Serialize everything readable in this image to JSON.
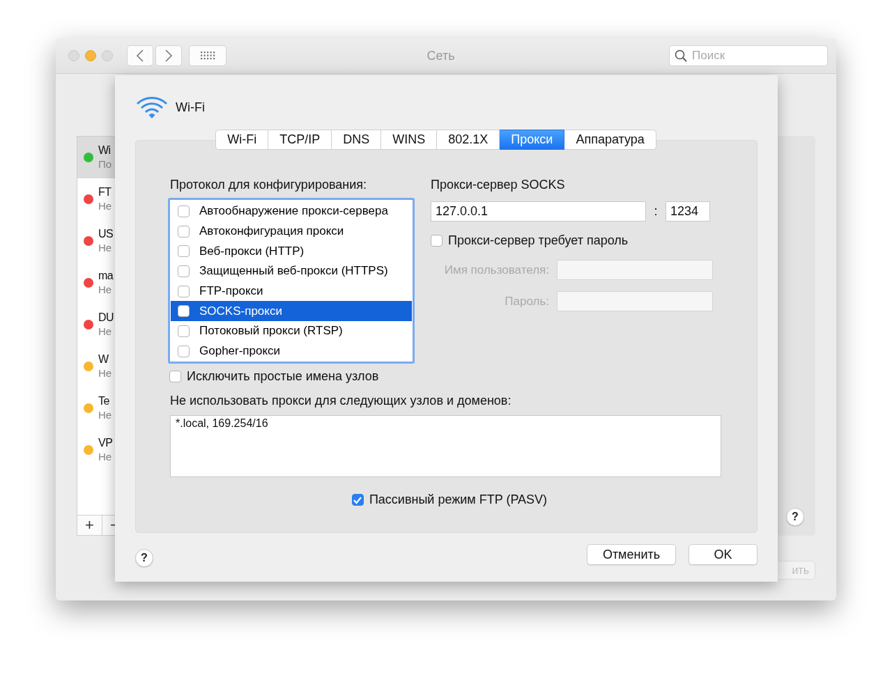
{
  "window": {
    "title": "Сеть",
    "search": {
      "placeholder": "Поиск"
    }
  },
  "services": [
    {
      "name": "Wi",
      "status": "По",
      "color": "#2fbf3c",
      "selected": true
    },
    {
      "name": "FT",
      "status": "Не",
      "color": "#f04545",
      "selected": false
    },
    {
      "name": "US",
      "status": "Не",
      "color": "#f04545",
      "selected": false
    },
    {
      "name": "ma",
      "status": "Не",
      "color": "#f04545",
      "selected": false
    },
    {
      "name": "DU",
      "status": "Не",
      "color": "#f04545",
      "selected": false
    },
    {
      "name": "W",
      "status": "Не",
      "color": "#f7b731",
      "selected": false
    },
    {
      "name": "Te",
      "status": "Не",
      "color": "#f7b731",
      "selected": false
    },
    {
      "name": "VP",
      "status": "Не",
      "color": "#f7b731",
      "selected": false
    }
  ],
  "list_buttons": [
    "+",
    "−"
  ],
  "window_help": "?",
  "apply_button": {
    "label": "ить",
    "disabled": true
  },
  "sheet": {
    "title": "Wi-Fi",
    "tabs": [
      {
        "label": "Wi-Fi",
        "selected": false
      },
      {
        "label": "TCP/IP",
        "selected": false
      },
      {
        "label": "DNS",
        "selected": false
      },
      {
        "label": "WINS",
        "selected": false
      },
      {
        "label": "802.1X",
        "selected": false
      },
      {
        "label": "Прокси",
        "selected": true
      },
      {
        "label": "Аппаратура",
        "selected": false
      }
    ],
    "protocols_label": "Протокол для конфигурирования:",
    "protocols": [
      {
        "label": "Автообнаружение прокси-сервера",
        "checked": false,
        "selected": false
      },
      {
        "label": "Автоконфигурация прокси",
        "checked": false,
        "selected": false
      },
      {
        "label": "Веб-прокси (HTTP)",
        "checked": false,
        "selected": false
      },
      {
        "label": "Защищенный веб-прокси (HTTPS)",
        "checked": false,
        "selected": false
      },
      {
        "label": "FTP-прокси",
        "checked": false,
        "selected": false
      },
      {
        "label": "SOCKS-прокси",
        "checked": false,
        "selected": true
      },
      {
        "label": "Потоковый прокси (RTSP)",
        "checked": false,
        "selected": false
      },
      {
        "label": "Gopher-прокси",
        "checked": false,
        "selected": false
      }
    ],
    "socks": {
      "label": "Прокси-сервер SOCKS",
      "server": "127.0.0.1",
      "separator": ":",
      "port": "1234"
    },
    "password_required": {
      "label": "Прокси-сервер требует пароль",
      "checked": false
    },
    "username": {
      "label": "Имя пользователя:",
      "disabled": true
    },
    "password": {
      "label": "Пароль:",
      "disabled": true
    },
    "exclude_simple": {
      "label": "Исключить простые имена узлов",
      "checked": false
    },
    "bypass_label": "Не использовать прокси для следующих узлов и доменов:",
    "bypass": "*.local, 169.254/16",
    "passive_ftp": {
      "label": "Пассивный режим FTP (PASV)",
      "checked": true
    },
    "help": "?",
    "buttons": [
      "Отменить",
      "OK"
    ]
  }
}
